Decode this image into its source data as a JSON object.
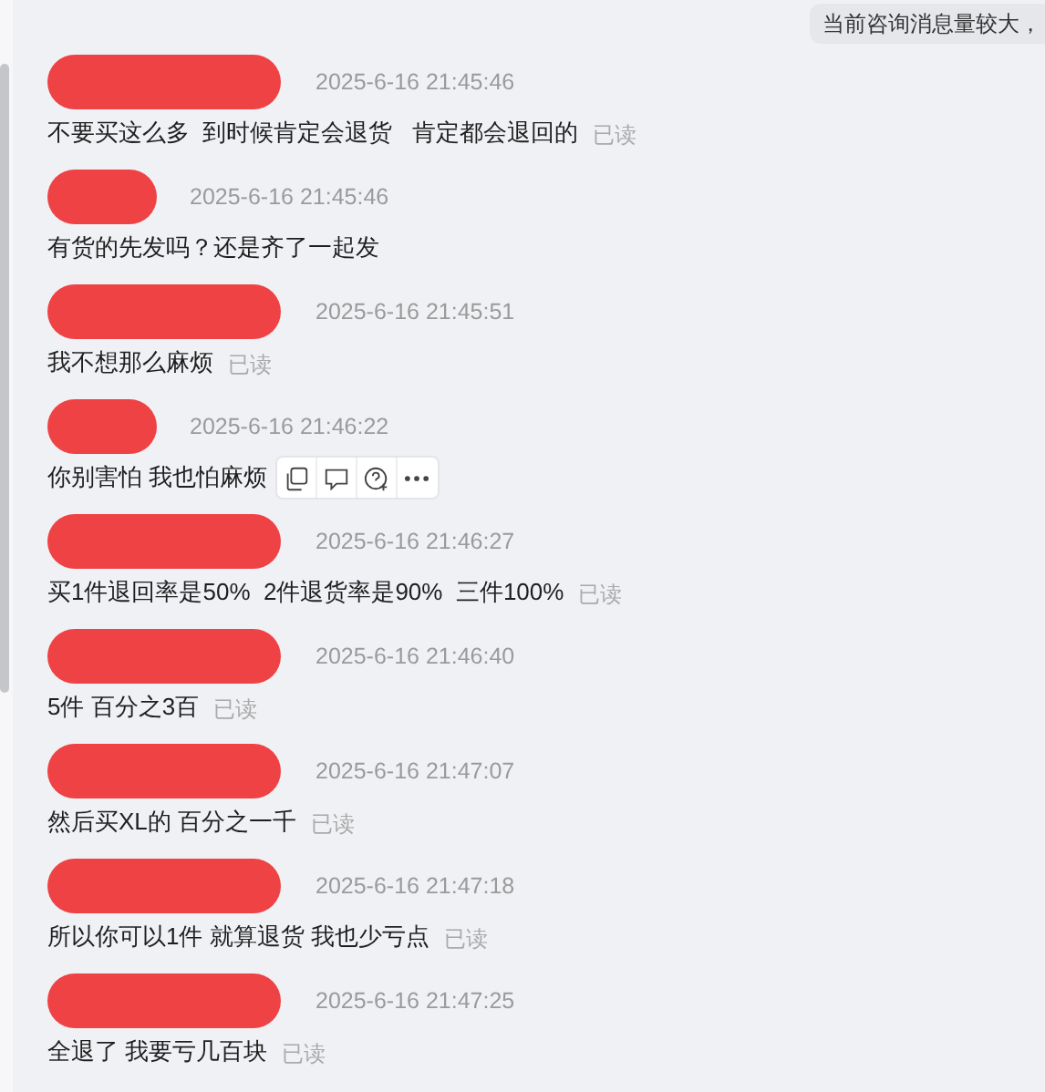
{
  "notice": "当前咨询消息量较大，",
  "messages": [
    {
      "kind": "long",
      "time": "2025-6-16 21:45:46",
      "text": "不要买这么多  到时候肯定会退货   肯定都会退回的",
      "read": "已读",
      "toolbar": false
    },
    {
      "kind": "short",
      "time": "2025-6-16 21:45:46",
      "text": "有货的先发吗？还是齐了一起发",
      "toolbar": false
    },
    {
      "kind": "long",
      "time": "2025-6-16 21:45:51",
      "text": "我不想那么麻烦",
      "read": "已读",
      "toolbar": false
    },
    {
      "kind": "short",
      "time": "2025-6-16 21:46:22",
      "text": "你别害怕 我也怕麻烦",
      "toolbar": true
    },
    {
      "kind": "long",
      "time": "2025-6-16 21:46:27",
      "text": "买1件退回率是50%  2件退货率是90%  三件100%",
      "read": "已读",
      "toolbar": false
    },
    {
      "kind": "long",
      "time": "2025-6-16 21:46:40",
      "text": "5件 百分之3百",
      "read": "已读",
      "toolbar": false
    },
    {
      "kind": "long",
      "time": "2025-6-16 21:47:07",
      "text": "然后买XL的 百分之一千",
      "read": "已读",
      "toolbar": false
    },
    {
      "kind": "long",
      "time": "2025-6-16 21:47:18",
      "text": "所以你可以1件 就算退货 我也少亏点",
      "read": "已读",
      "toolbar": false
    },
    {
      "kind": "long",
      "time": "2025-6-16 21:47:25",
      "text": "全退了 我要亏几百块",
      "read": "已读",
      "toolbar": false
    }
  ]
}
